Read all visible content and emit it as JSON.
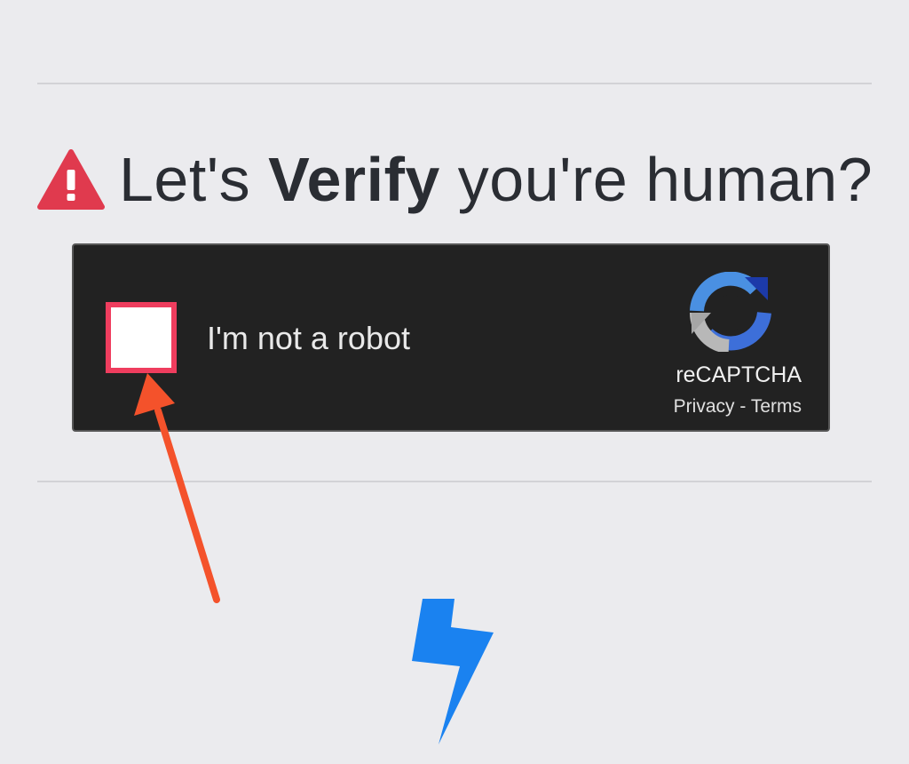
{
  "heading": {
    "prefix": "Let's ",
    "emphasis": "Verify",
    "suffix": " you're human?",
    "icon": "warning-triangle-icon"
  },
  "captcha": {
    "checkbox_label": "I'm not a robot",
    "checked": false,
    "brand": "reCAPTCHA",
    "privacy_link": "Privacy",
    "separator": " - ",
    "terms_link": "Terms",
    "logo_icon": "recaptcha-logo-icon"
  },
  "annotation": {
    "arrow_icon": "pointer-arrow-icon",
    "arrow_color": "#f4522b"
  },
  "footer": {
    "icon": "lightning-bolt-icon",
    "icon_color": "#1a82f0"
  },
  "colors": {
    "background": "#ebebee",
    "warning": "#e03a4e",
    "captcha_bg": "#222222",
    "checkbox_border": "#ef3d5e"
  }
}
